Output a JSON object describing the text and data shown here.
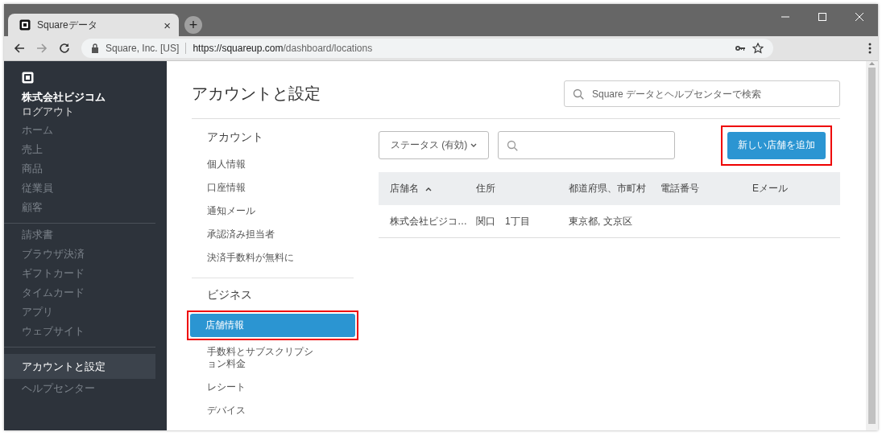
{
  "browser": {
    "tab": {
      "title": "Squareデータ",
      "close": "×"
    },
    "new_tab": "+",
    "url": {
      "site": "Square, Inc. [US]",
      "origin": "https://squareup.com",
      "path": "/dashboard/locations"
    }
  },
  "sidebar": {
    "company": "株式会社ビジコム",
    "logout": "ログアウト",
    "groups": [
      {
        "items": [
          {
            "label": "ホーム",
            "selected": false
          },
          {
            "label": "売上",
            "selected": false
          },
          {
            "label": "商品",
            "selected": false
          },
          {
            "label": "従業員",
            "selected": false
          },
          {
            "label": "顧客",
            "selected": false
          }
        ]
      },
      {
        "items": [
          {
            "label": "請求書",
            "selected": false
          },
          {
            "label": "ブラウザ決済",
            "selected": false
          },
          {
            "label": "ギフトカード",
            "selected": false
          },
          {
            "label": "タイムカード",
            "selected": false
          },
          {
            "label": "アプリ",
            "selected": false
          },
          {
            "label": "ウェブサイト",
            "selected": false
          }
        ]
      },
      {
        "items": [
          {
            "label": "アカウントと設定",
            "selected": true
          },
          {
            "label": "ヘルプセンター",
            "selected": false
          }
        ]
      }
    ]
  },
  "page": {
    "title": "アカウントと設定",
    "search": {
      "placeholder": "Square データとヘルプセンターで検索"
    }
  },
  "settings_nav": [
    {
      "heading": "アカウント",
      "items": [
        {
          "label": "個人情報",
          "selected": false,
          "highlighted": false
        },
        {
          "label": "口座情報",
          "selected": false,
          "highlighted": false
        },
        {
          "label": "通知メール",
          "selected": false,
          "highlighted": false
        },
        {
          "label": "承認済み担当者",
          "selected": false,
          "highlighted": false
        },
        {
          "label": "決済手数料が無料に",
          "selected": false,
          "highlighted": false
        }
      ]
    },
    {
      "heading": "ビジネス",
      "items": [
        {
          "label": "店舗情報",
          "selected": true,
          "highlighted": true
        },
        {
          "label": "手数料とサブスクリプション料金",
          "selected": false,
          "highlighted": false
        },
        {
          "label": "レシート",
          "selected": false,
          "highlighted": false
        },
        {
          "label": "デバイス",
          "selected": false,
          "highlighted": false
        }
      ]
    }
  ],
  "toolbar": {
    "status_filter": "ステータス (有効)",
    "add_button": {
      "label": "新しい店舗を追加",
      "highlighted": true
    }
  },
  "table": {
    "columns": [
      {
        "label": "店舗名",
        "sorted": true
      },
      {
        "label": "住所",
        "sorted": false
      },
      {
        "label": "都道府県、市町村",
        "sorted": false
      },
      {
        "label": "電話番号",
        "sorted": false
      },
      {
        "label": "Eメール",
        "sorted": false
      }
    ],
    "rows": [
      {
        "cells": [
          "株式会社ビジコ…",
          "関口　1丁目",
          "東京都, 文京区"
        ]
      }
    ]
  }
}
